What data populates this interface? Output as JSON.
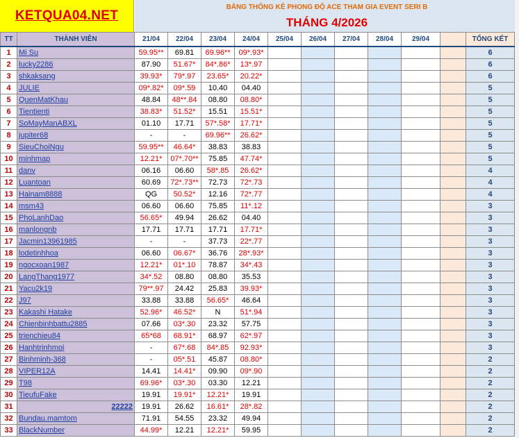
{
  "brand": "KETQUA04.NET",
  "subtitle": "BẢNG THỐNG KÊ PHONG ĐỘ ACE THAM GIA EVENT SERI B",
  "month_title": "THÁNG 4/2026",
  "headers": {
    "tt": "TT",
    "member": "THÀNH VIÊN",
    "dates": [
      "21/04",
      "22/04",
      "23/04",
      "24/04",
      "25/04",
      "26/04",
      "27/04",
      "28/04",
      "29/04"
    ],
    "total": "TỔNG KẾT"
  },
  "rows": [
    {
      "tt": "1",
      "name": "Mi Su",
      "d": [
        "59.95**",
        "69.81",
        "69.96**",
        "09*.93*"
      ],
      "total": "6"
    },
    {
      "tt": "2",
      "name": "lucky2286",
      "d": [
        "87.90",
        "51.67*",
        "84*.86*",
        "13*.97"
      ],
      "total": "6"
    },
    {
      "tt": "3",
      "name": "shkaksang",
      "d": [
        "39.93*",
        "79*.97",
        "23.65*",
        "20.22*"
      ],
      "total": "6"
    },
    {
      "tt": "4",
      "name": "JULIE",
      "d": [
        "09*.82*",
        "09*.59",
        "10.40",
        "04.40"
      ],
      "total": "5"
    },
    {
      "tt": "5",
      "name": "QuenMatKhau",
      "d": [
        "48.84",
        "48**.84",
        "08.80",
        "08.80*"
      ],
      "total": "5"
    },
    {
      "tt": "6",
      "name": "Tientienti",
      "d": [
        "38.83*",
        "51.52*",
        "15.51",
        "15.51*"
      ],
      "total": "5"
    },
    {
      "tt": "7",
      "name": "SoMayManABXL",
      "d": [
        "01.10",
        "17.71",
        "57*.58*",
        "17.71*"
      ],
      "total": "5"
    },
    {
      "tt": "8",
      "name": "jupiter68",
      "d": [
        "-",
        "-",
        "69.96**",
        "26.62*"
      ],
      "total": "5"
    },
    {
      "tt": "9",
      "name": "SieuChoiNgu",
      "d": [
        "59.95**",
        "46.64*",
        "38.83",
        "38.83"
      ],
      "total": "5"
    },
    {
      "tt": "10",
      "name": "minhmap",
      "d": [
        "12.21*",
        "07*.70**",
        "75.85",
        "47.74*"
      ],
      "total": "5"
    },
    {
      "tt": "11",
      "name": "danv",
      "d": [
        "06.16",
        "06.60",
        "58*.85",
        "26.62*"
      ],
      "total": "4"
    },
    {
      "tt": "12",
      "name": "Luantoan",
      "d": [
        "60.69",
        "72*.73**",
        "72.73",
        "72*.73"
      ],
      "total": "4"
    },
    {
      "tt": "13",
      "name": "Hainam8888",
      "d": [
        "QG",
        "50.52*",
        "12.16",
        "72*.77"
      ],
      "total": "4"
    },
    {
      "tt": "14",
      "name": "msm43",
      "d": [
        "06.60",
        "06.60",
        "75.85",
        "11*.12"
      ],
      "total": "3"
    },
    {
      "tt": "15",
      "name": "PhoLanhDao",
      "d": [
        "56.65*",
        "49.94",
        "26.62",
        "04.40"
      ],
      "total": "3"
    },
    {
      "tt": "16",
      "name": "manlongnb",
      "d": [
        "17.71",
        "17.71",
        "17.71",
        "17.71*"
      ],
      "total": "3"
    },
    {
      "tt": "17",
      "name": "Jacmin13961985",
      "d": [
        "-",
        "-",
        "37.73",
        "22*.77"
      ],
      "total": "3"
    },
    {
      "tt": "18",
      "name": "lodetinhhoa",
      "d": [
        "06.60",
        "06.67*",
        "36.76",
        "28*.93*"
      ],
      "total": "3"
    },
    {
      "tt": "19",
      "name": "ngocxoan1987",
      "d": [
        "12.21*",
        "01*.10",
        "78.87",
        "34*.43"
      ],
      "total": "3"
    },
    {
      "tt": "20",
      "name": "LangThang1977",
      "d": [
        "34*.52",
        "08.80",
        "08.80",
        "35.53"
      ],
      "total": "3"
    },
    {
      "tt": "21",
      "name": "Yacu2k19",
      "d": [
        "79**.97",
        "24.42",
        "25.83",
        "39.93*"
      ],
      "total": "3"
    },
    {
      "tt": "22",
      "name": "J97",
      "d": [
        "33.88",
        "33.88",
        "56.65*",
        "46.64"
      ],
      "total": "3"
    },
    {
      "tt": "23",
      "name": "Kakashi Hatake",
      "d": [
        "52.96*",
        "46.52*",
        "N",
        "51*.94"
      ],
      "total": "3"
    },
    {
      "tt": "24",
      "name": "Chienbinhbattu2885",
      "d": [
        "07.66",
        "03*.30",
        "23.32",
        "57.75"
      ],
      "total": "3"
    },
    {
      "tt": "25",
      "name": "trienchieu84",
      "d": [
        "65*68",
        "68.91*",
        "68.97",
        "62*.97"
      ],
      "total": "3"
    },
    {
      "tt": "26",
      "name": "Hanhtrinhmoi",
      "d": [
        "-",
        "67*.68",
        "84*.85",
        "92.93*"
      ],
      "total": "3"
    },
    {
      "tt": "27",
      "name": "Binhminh-368",
      "d": [
        "-",
        "05*.51",
        "45.87",
        "08.80*"
      ],
      "total": "2"
    },
    {
      "tt": "28",
      "name": "VIPER12A",
      "d": [
        "14.41",
        "14.41*",
        "09.90",
        "09*.90"
      ],
      "total": "2"
    },
    {
      "tt": "29",
      "name": "T98",
      "d": [
        "69.96*",
        "03*.30",
        "03.30",
        "12.21"
      ],
      "total": "2"
    },
    {
      "tt": "30",
      "name": "TieufuFake",
      "d": [
        "19.91",
        "19.91*",
        "12.21*",
        "19.91"
      ],
      "total": "2"
    },
    {
      "tt": "31",
      "name": "22222",
      "d": [
        "19.91",
        "26.62",
        "16.61*",
        "28*.82"
      ],
      "total": "2"
    },
    {
      "tt": "32",
      "name": "Bundau.mamtom",
      "d": [
        "71.91",
        "54.55",
        "23.32",
        "49.94"
      ],
      "total": "2"
    },
    {
      "tt": "33",
      "name": "BlackNumber",
      "d": [
        "44.99*",
        "12.21",
        "12.21*",
        "59.95"
      ],
      "total": "2"
    }
  ],
  "colors": {
    "brand_bg": "#ffff00",
    "brand_text": "#e00000",
    "header_bg": "#dce6f1",
    "member_bg": "#ccc0da",
    "value_red": "#e00000"
  }
}
